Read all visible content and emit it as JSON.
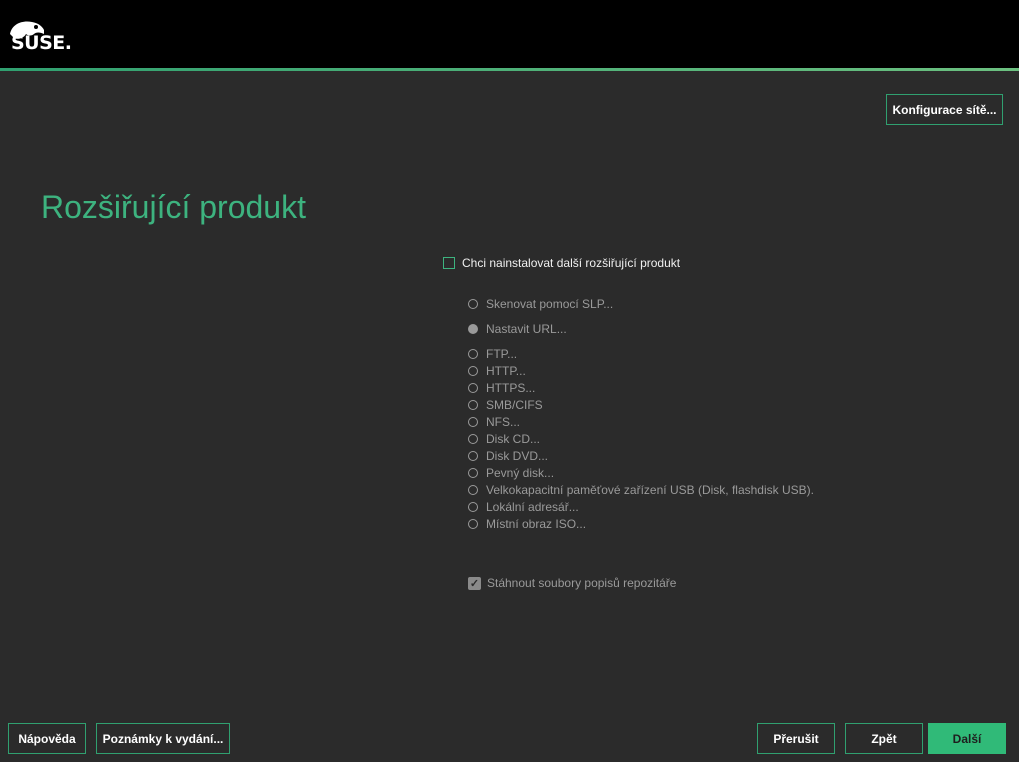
{
  "header": {
    "logo_text": "SUSE."
  },
  "toolbar": {
    "network_config": "Konfigurace sítě..."
  },
  "page": {
    "title": "Rozšiřující produkt"
  },
  "addon_checkbox": {
    "label": "Chci nainstalovat další rozšiřující produkt",
    "checked": false
  },
  "sources": [
    {
      "label": "Skenovat pomocí SLP...",
      "selected": false
    },
    {
      "label": "Nastavit URL...",
      "selected": true
    },
    {
      "label": "FTP...",
      "selected": false
    },
    {
      "label": "HTTP...",
      "selected": false
    },
    {
      "label": "HTTPS...",
      "selected": false
    },
    {
      "label": "SMB/CIFS",
      "selected": false
    },
    {
      "label": "NFS...",
      "selected": false
    },
    {
      "label": "Disk CD...",
      "selected": false
    },
    {
      "label": "Disk DVD...",
      "selected": false
    },
    {
      "label": "Pevný disk...",
      "selected": false
    },
    {
      "label": "Velkokapacitní paměťové zařízení USB (Disk, flashdisk USB).",
      "selected": false
    },
    {
      "label": "Lokální adresář...",
      "selected": false
    },
    {
      "label": "Místní obraz ISO...",
      "selected": false
    }
  ],
  "download_checkbox": {
    "label": "Stáhnout soubory popisů repozitáře",
    "checked": true
  },
  "footer": {
    "help": "Nápověda",
    "release_notes": "Poznámky k vydání...",
    "abort": "Přerušit",
    "back": "Zpět",
    "next": "Další"
  },
  "colors": {
    "accent": "#30ba78",
    "title": "#3db37f",
    "background": "#2b2b2b"
  }
}
